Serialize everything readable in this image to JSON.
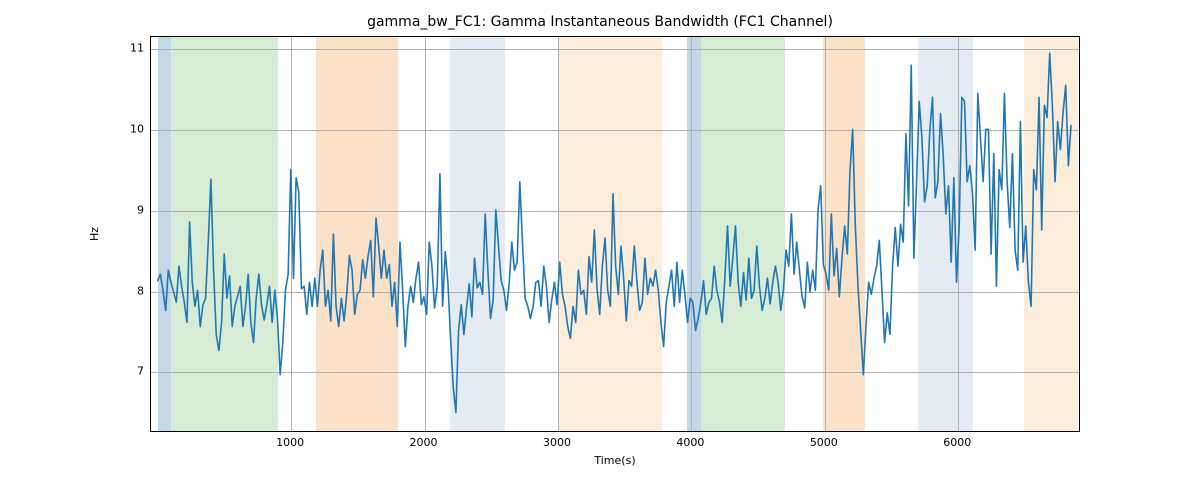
{
  "chart_data": {
    "type": "line",
    "title": "gamma_bw_FC1: Gamma Instantaneous Bandwidth (FC1 Channel)",
    "xlabel": "Time(s)",
    "ylabel": "Hz",
    "xlim": [
      -50,
      6920
    ],
    "ylim": [
      6.25,
      11.15
    ],
    "xticks": [
      1000,
      2000,
      3000,
      4000,
      5000,
      6000
    ],
    "yticks": [
      7,
      8,
      9,
      10,
      11
    ],
    "grid": true,
    "line_color": "#1f77b4",
    "bands": [
      {
        "x0": 0,
        "x1": 100,
        "color": "#8fb7d6",
        "alpha": 0.55
      },
      {
        "x0": 100,
        "x1": 900,
        "color": "#b7ddb0",
        "alpha": 0.55
      },
      {
        "x0": 1190,
        "x1": 1800,
        "color": "#f7c99b",
        "alpha": 0.55
      },
      {
        "x0": 2190,
        "x1": 2600,
        "color": "#cedbe8",
        "alpha": 0.55
      },
      {
        "x0": 3000,
        "x1": 3780,
        "color": "#fbe6ce",
        "alpha": 0.75
      },
      {
        "x0": 3970,
        "x1": 4070,
        "color": "#8fb7d6",
        "alpha": 0.55
      },
      {
        "x0": 4070,
        "x1": 4700,
        "color": "#b7ddb0",
        "alpha": 0.55
      },
      {
        "x0": 4990,
        "x1": 5300,
        "color": "#f7c99b",
        "alpha": 0.55
      },
      {
        "x0": 5700,
        "x1": 6110,
        "color": "#cedbe8",
        "alpha": 0.55
      },
      {
        "x0": 6490,
        "x1": 6900,
        "color": "#fbe6ce",
        "alpha": 0.75
      }
    ],
    "x": [
      0,
      20,
      40,
      60,
      80,
      100,
      120,
      140,
      160,
      180,
      200,
      220,
      240,
      260,
      280,
      300,
      320,
      340,
      360,
      380,
      400,
      420,
      440,
      460,
      480,
      500,
      520,
      540,
      560,
      580,
      600,
      620,
      640,
      660,
      680,
      700,
      720,
      740,
      760,
      780,
      800,
      820,
      840,
      860,
      880,
      900,
      920,
      940,
      960,
      980,
      1000,
      1020,
      1040,
      1060,
      1080,
      1100,
      1120,
      1140,
      1160,
      1180,
      1200,
      1220,
      1240,
      1260,
      1280,
      1300,
      1320,
      1340,
      1360,
      1380,
      1400,
      1420,
      1440,
      1460,
      1480,
      1500,
      1520,
      1540,
      1560,
      1580,
      1600,
      1620,
      1640,
      1660,
      1680,
      1700,
      1720,
      1740,
      1760,
      1780,
      1800,
      1820,
      1840,
      1860,
      1880,
      1900,
      1920,
      1940,
      1960,
      1980,
      2000,
      2020,
      2040,
      2060,
      2080,
      2100,
      2120,
      2140,
      2160,
      2180,
      2200,
      2220,
      2240,
      2260,
      2280,
      2300,
      2320,
      2340,
      2360,
      2380,
      2400,
      2420,
      2440,
      2460,
      2480,
      2500,
      2520,
      2540,
      2560,
      2580,
      2600,
      2620,
      2640,
      2660,
      2680,
      2700,
      2720,
      2740,
      2760,
      2780,
      2800,
      2820,
      2840,
      2860,
      2880,
      2900,
      2920,
      2940,
      2960,
      2980,
      3000,
      3020,
      3040,
      3060,
      3080,
      3100,
      3120,
      3140,
      3160,
      3180,
      3200,
      3220,
      3240,
      3260,
      3280,
      3300,
      3320,
      3340,
      3360,
      3380,
      3400,
      3420,
      3440,
      3460,
      3480,
      3500,
      3520,
      3540,
      3560,
      3580,
      3600,
      3620,
      3640,
      3660,
      3680,
      3700,
      3720,
      3740,
      3760,
      3780,
      3800,
      3820,
      3840,
      3860,
      3880,
      3900,
      3920,
      3940,
      3960,
      3980,
      4000,
      4020,
      4040,
      4060,
      4080,
      4100,
      4120,
      4140,
      4160,
      4180,
      4200,
      4220,
      4240,
      4260,
      4280,
      4300,
      4320,
      4340,
      4360,
      4380,
      4400,
      4420,
      4440,
      4460,
      4480,
      4500,
      4520,
      4540,
      4560,
      4580,
      4600,
      4620,
      4640,
      4660,
      4680,
      4700,
      4720,
      4740,
      4760,
      4780,
      4800,
      4820,
      4840,
      4860,
      4880,
      4900,
      4920,
      4940,
      4960,
      4980,
      5000,
      5020,
      5040,
      5060,
      5080,
      5100,
      5120,
      5140,
      5160,
      5180,
      5200,
      5220,
      5240,
      5260,
      5280,
      5300,
      5320,
      5340,
      5360,
      5380,
      5400,
      5420,
      5440,
      5460,
      5480,
      5500,
      5520,
      5540,
      5560,
      5580,
      5600,
      5620,
      5640,
      5660,
      5680,
      5700,
      5720,
      5740,
      5760,
      5780,
      5800,
      5820,
      5840,
      5860,
      5880,
      5900,
      5920,
      5940,
      5960,
      5980,
      6000,
      6020,
      6040,
      6060,
      6080,
      6100,
      6120,
      6140,
      6160,
      6180,
      6200,
      6220,
      6240,
      6260,
      6280,
      6300,
      6320,
      6340,
      6360,
      6380,
      6400,
      6420,
      6440,
      6460,
      6480,
      6500,
      6520,
      6540,
      6560,
      6580,
      6600,
      6620,
      6640,
      6660,
      6680,
      6700,
      6720,
      6740,
      6760,
      6780,
      6800,
      6820,
      6840,
      6860
    ],
    "values": [
      8.12,
      8.2,
      8.0,
      7.75,
      8.25,
      8.1,
      7.98,
      7.85,
      8.3,
      8.05,
      7.85,
      7.6,
      8.85,
      8.1,
      7.8,
      8.0,
      7.55,
      7.82,
      7.9,
      8.6,
      9.38,
      8.25,
      7.45,
      7.25,
      7.6,
      8.45,
      7.9,
      8.18,
      7.55,
      7.8,
      7.92,
      8.05,
      7.55,
      7.8,
      8.2,
      7.6,
      7.35,
      7.9,
      8.2,
      7.82,
      7.63,
      7.82,
      8.05,
      7.6,
      8.0,
      7.65,
      6.95,
      7.35,
      8.0,
      8.2,
      9.5,
      8.15,
      9.4,
      9.22,
      8.02,
      8.05,
      7.7,
      8.1,
      7.8,
      8.15,
      7.8,
      8.25,
      8.5,
      7.8,
      8.0,
      7.62,
      8.7,
      7.8,
      7.55,
      7.9,
      7.62,
      7.95,
      8.43,
      8.25,
      7.7,
      7.95,
      8.0,
      8.38,
      8.15,
      8.42,
      8.62,
      7.92,
      8.9,
      8.55,
      8.15,
      8.5,
      8.15,
      8.32,
      7.8,
      8.1,
      7.55,
      8.6,
      8.0,
      7.3,
      7.8,
      8.05,
      7.85,
      8.15,
      8.35,
      7.82,
      7.92,
      7.7,
      8.6,
      8.3,
      7.78,
      8.05,
      9.45,
      7.8,
      8.48,
      8.1,
      7.4,
      6.8,
      6.48,
      7.5,
      7.82,
      7.45,
      7.78,
      8.08,
      7.67,
      8.4,
      8.03,
      8.1,
      7.95,
      8.95,
      8.25,
      7.65,
      7.88,
      9.0,
      8.55,
      8.12,
      8.0,
      7.75,
      8.08,
      8.6,
      8.25,
      8.35,
      9.35,
      8.6,
      7.9,
      7.8,
      7.65,
      7.8,
      8.1,
      8.12,
      7.8,
      8.3,
      8.05,
      7.6,
      7.88,
      8.1,
      7.82,
      8.35,
      7.95,
      7.8,
      7.55,
      7.4,
      7.8,
      7.6,
      8.25,
      7.95,
      8.0,
      7.7,
      8.42,
      8.1,
      8.75,
      8.02,
      7.7,
      8.3,
      8.65,
      8.0,
      7.8,
      9.2,
      8.3,
      7.95,
      8.55,
      8.15,
      7.62,
      8.12,
      8.05,
      8.55,
      8.1,
      7.75,
      7.85,
      8.4,
      7.95,
      8.15,
      8.05,
      8.25,
      8.0,
      7.6,
      7.3,
      7.85,
      8.05,
      8.25,
      7.8,
      8.35,
      7.85,
      8.25,
      7.95,
      7.6,
      7.9,
      7.85,
      7.5,
      7.65,
      7.85,
      8.12,
      7.7,
      7.85,
      7.9,
      8.3,
      8.0,
      7.85,
      7.6,
      8.15,
      8.8,
      8.05,
      8.4,
      8.8,
      8.1,
      7.8,
      8.22,
      7.88,
      8.4,
      7.9,
      8.0,
      8.55,
      8.05,
      7.75,
      7.9,
      8.15,
      7.83,
      8.1,
      8.3,
      8.1,
      7.75,
      8.0,
      8.5,
      8.3,
      8.95,
      8.2,
      8.6,
      8.25,
      7.92,
      7.78,
      8.35,
      7.98,
      8.25,
      8.0,
      9.0,
      9.3,
      8.32,
      8.2,
      8.0,
      8.95,
      8.18,
      8.52,
      7.92,
      8.4,
      8.8,
      8.45,
      9.48,
      10.0,
      8.8,
      8.05,
      7.5,
      6.95,
      7.55,
      8.1,
      7.95,
      8.15,
      8.3,
      8.62,
      8.0,
      7.35,
      7.72,
      7.45,
      8.3,
      8.78,
      8.3,
      8.82,
      8.6,
      9.95,
      9.05,
      10.8,
      8.4,
      9.35,
      10.35,
      9.9,
      9.1,
      9.3,
      10.0,
      10.4,
      9.15,
      9.35,
      10.2,
      9.68,
      8.95,
      9.3,
      8.35,
      9.4,
      8.1,
      8.8,
      10.4,
      10.35,
      9.35,
      9.55,
      9.2,
      8.5,
      10.45,
      9.9,
      9.35,
      10.0,
      10.0,
      8.45,
      9.7,
      8.05,
      9.5,
      9.25,
      10.45,
      9.35,
      8.78,
      9.7,
      8.5,
      8.25,
      10.1,
      8.35,
      8.8,
      8.1,
      7.8,
      9.5,
      9.25,
      10.4,
      8.75,
      10.3,
      10.15,
      10.95,
      10.3,
      9.35,
      10.1,
      9.75,
      10.2,
      10.55,
      9.55,
      10.05
    ]
  }
}
